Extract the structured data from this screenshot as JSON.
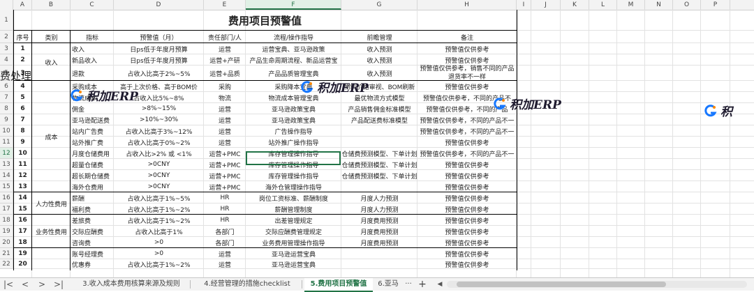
{
  "columns": [
    "A",
    "B",
    "C",
    "D",
    "E",
    "F",
    "G",
    "H",
    "I",
    "J",
    "K",
    "L",
    "M",
    "N",
    "O",
    "P"
  ],
  "selected_column": "F",
  "rows": [
    {
      "n": "1"
    },
    {
      "n": "2"
    },
    {
      "n": "3",
      "a": "1",
      "c": "收入",
      "d": "日ps低于年度月预算",
      "e": "运营",
      "f": "运营宝典、亚马逊政策",
      "g": "收入预测",
      "h": "预警值仅供参考"
    },
    {
      "n": "4",
      "a": "2",
      "c": "新品收入",
      "d": "日ps低于年度月预算",
      "e": "运营+产研",
      "f": "产品生命周期流程、新品运营宝",
      "g": "收入预测",
      "h": "预警值仅供参考"
    },
    {
      "n": "5",
      "a": "3",
      "c": "退款",
      "d": "占收入比高于2%~5%",
      "e": "运营+品质",
      "f": "产品品质管理宝典",
      "g": "收入预测",
      "h": "预警值仅供参考，销售不同的产品退货率不一样"
    },
    {
      "n": "6",
      "a": "4",
      "c": "采购成本",
      "d": "高于上次价格、高于BOM价",
      "e": "采购",
      "f": "采购降本宝典",
      "g": "物料价格审视、BOM刷新",
      "h": "预警值仅供参考"
    },
    {
      "n": "7",
      "a": "5",
      "c": "物流成本",
      "d": "占收入比5%~8%",
      "e": "物流",
      "f": "物流成本管理宝典",
      "g": "最优物流方式模型",
      "h": "预警值仅供参考，不同的产品不"
    },
    {
      "n": "8",
      "a": "6",
      "c": "佣金",
      "d": ">8%~15%",
      "e": "运营",
      "f": "亚马逊政策宝典",
      "g": "产品销售佣金标准模型",
      "h": "预警值仅供参考，不同的产品"
    },
    {
      "n": "9",
      "a": "7",
      "c": "亚马逊配送费",
      "d": ">10%~30%",
      "e": "运营",
      "f": "亚马逊政策宝典",
      "g": "产品配送费标准模型",
      "h": "预警值仅供参考，不同的产品不一"
    },
    {
      "n": "10",
      "a": "8",
      "c": "站内广告费",
      "d": "占收入比高于3%~12%",
      "e": "运营",
      "f": "广告操作指导",
      "g": "",
      "h": "预警值仅供参考，不同的产品不一"
    },
    {
      "n": "11",
      "a": "9",
      "c": "站外推广费",
      "d": "占收入比高于0%~2%",
      "e": "运营",
      "f": "站外推广操作指导",
      "g": "",
      "h": "预警值仅供参考"
    },
    {
      "n": "12",
      "a": "10",
      "c": "月度仓储费用",
      "d": "占收入比>2% 或 <1%",
      "e": "运营+PMC",
      "f": "库存管理操作指导",
      "g": "仓储费预测模型、下单计划",
      "h": "预警值仅供参考，不同的产品不一"
    },
    {
      "n": "13",
      "a": "11",
      "c": "超量仓储费",
      "d": ">0CNY",
      "e": "运营+PMC",
      "f": "库存管理操作指导",
      "g": "仓储费预测模型、下单计划",
      "h": "预警值仅供参考"
    },
    {
      "n": "14",
      "a": "12",
      "c": "超长期仓储费",
      "d": ">0CNY",
      "e": "运营+PMC",
      "f": "库存管理操作指导",
      "g": "仓储费预测模型、下单计划",
      "h": "预警值仅供参考"
    },
    {
      "n": "15",
      "a": "13",
      "c": "海外仓费用",
      "d": ">0CNY",
      "e": "运营+PMC",
      "f": "海外仓管理操作指导",
      "g": "",
      "h": "预警值仅供参考"
    },
    {
      "n": "16",
      "a": "14",
      "c": "薪酬",
      "d": "占收入比高于1%~5%",
      "e": "HR",
      "f": "岗位工资标准、薪酬制度",
      "g": "月度人力预测",
      "h": "预警值仅供参考"
    },
    {
      "n": "17",
      "a": "15",
      "c": "福利费",
      "d": "占收入比高于1%~2%",
      "e": "HR",
      "f": "薪酬管理制度",
      "g": "月度人力预测",
      "h": "预警值仅供参考"
    },
    {
      "n": "18",
      "a": "16",
      "c": "差旅费",
      "d": "占收入比高于1%~2%",
      "e": "HR",
      "f": "出差管理规定",
      "g": "月度费用预测",
      "h": "预警值仅供参考"
    },
    {
      "n": "19",
      "a": "17",
      "c": "交际应酬费",
      "d": "占收入比高于1%",
      "e": "各部门",
      "f": "交际应酬费管理规定",
      "g": "月度费用预测",
      "h": "预警值仅供参考"
    },
    {
      "n": "20",
      "a": "18",
      "c": "咨询费",
      "d": ">0",
      "e": "各部门",
      "f": "业务费用管理操作指导",
      "g": "月度费用预测",
      "h": "预警值仅供参考"
    },
    {
      "n": "21",
      "a": "19",
      "c": "账号经理费",
      "d": ">0",
      "e": "运营",
      "f": "亚马逊运营宝典",
      "g": "",
      "h": "预警值仅供参考"
    },
    {
      "n": "22",
      "a": "20",
      "c": "优惠券",
      "d": "占收入比高于1%~2%",
      "e": "运营",
      "f": "亚马逊运营宝典",
      "g": "",
      "h": "预警值仅供参考"
    }
  ],
  "title": "费用项目预警值",
  "headers": [
    "序号",
    "类别",
    "指标",
    "预警值（月）",
    "责任部门/人",
    "流程/操作指导",
    "前瞻管理",
    "备注"
  ],
  "categories": [
    {
      "label": "收入"
    },
    {
      "label": "成本"
    },
    {
      "label": "人力性费用"
    },
    {
      "label": "业务性费用"
    }
  ],
  "fragment_text": "费处理",
  "watermark": {
    "text": "积加ERP",
    "partial": "积",
    "brand_color": "#1677ff",
    "accent_color": "#ff8a00"
  },
  "tabs": {
    "nav": [
      "|<",
      "<",
      ">",
      ">|"
    ],
    "items": [
      {
        "label": "3.收入成本费用核算来源及规则"
      },
      {
        "label": "4.经营管理的措施checklist"
      },
      {
        "label": "5.费用项目预警值"
      },
      {
        "label": "6.亚马"
      }
    ],
    "active": 2,
    "more": "···",
    "add": "+"
  },
  "colors": {
    "accent": "#217346",
    "grid": "#e2e2e2",
    "header_bg": "#f3f3f3"
  }
}
